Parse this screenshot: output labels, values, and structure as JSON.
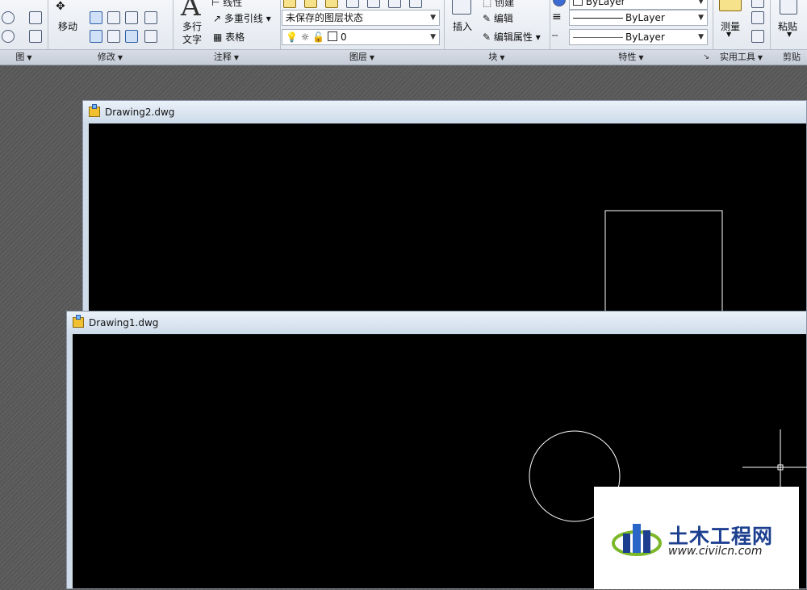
{
  "ribbon": {
    "panels": {
      "draw": "图",
      "modify": "修改",
      "annotation": "注释",
      "layers": "图层",
      "block": "块",
      "properties": "特性",
      "utilities": "实用工具",
      "clipboard": "剪贴板"
    },
    "modify": {
      "move_label": "移动"
    },
    "annotation": {
      "mtext_line1": "多行",
      "mtext_line2": "文字",
      "linear_label": "线性",
      "mleader_label": "多重引线",
      "table_label": "表格"
    },
    "layers": {
      "state_value": "未保存的图层状态",
      "current_layer": "0"
    },
    "block": {
      "insert_label": "插入",
      "create_label": "创建",
      "edit_label": "编辑",
      "edit_attr_label": "编辑属性"
    },
    "properties": {
      "color_value": "ByLayer",
      "linetype_value": "ByLayer",
      "lineweight_value": "ByLayer"
    },
    "utilities": {
      "measure_label": "测量"
    },
    "clipboard": {
      "paste_label": "粘贴"
    }
  },
  "windows": [
    {
      "title": "Drawing2.dwg"
    },
    {
      "title": "Drawing1.dwg"
    }
  ],
  "watermark": {
    "name": "土木工程网",
    "url": "www.civilcn.com"
  },
  "colors": {
    "canvas": "#000000",
    "geometry": "#ffffff",
    "ribbon": "#e6eaf0",
    "watermark_text": "#1c3f8f"
  }
}
